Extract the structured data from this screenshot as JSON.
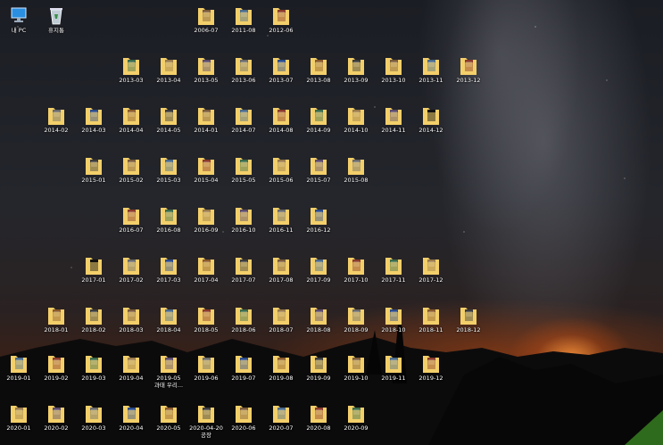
{
  "desktop": {
    "system_icons": [
      {
        "label": "내 PC",
        "icon": "this-pc-icon"
      },
      {
        "label": "휴지통",
        "icon": "recycle-bin-icon"
      }
    ],
    "folder_rows": [
      [
        "2006-07",
        "2011-08",
        "2012-06"
      ],
      [
        "2013-03",
        "2013-04",
        "2013-05",
        "2013-06",
        "2013-07",
        "2013-08",
        "2013-09",
        "2013-10",
        "2013-11",
        "2013-12"
      ],
      [
        "2014-02",
        "2014-03",
        "2014-04",
        "2014-05",
        "2014-01",
        "2014-07",
        "2014-08",
        "2014-09",
        "2014-10",
        "2014-11",
        "2014-12"
      ],
      [
        "2015-01",
        "2015-02",
        "2015-03",
        "2015-04",
        "2015-05",
        "2015-06",
        "2015-07",
        "2015-08"
      ],
      [
        "2016-07",
        "2016-08",
        "2016-09",
        "2016-10",
        "2016-11",
        "2016-12"
      ],
      [
        "2017-01",
        "2017-02",
        "2017-03",
        "2017-04",
        "2017-07",
        "2017-08",
        "2017-09",
        "2017-10",
        "2017-11",
        "2017-12"
      ],
      [
        "2018-01",
        "2018-02",
        "2018-03",
        "2018-04",
        "2018-05",
        "2018-06",
        "2018-07",
        "2018-08",
        "2018-09",
        "2018-10",
        "2018-11",
        "2018-12"
      ],
      [
        "2019-01",
        "2019-02",
        "2019-03",
        "2019-04",
        "2019-05",
        "2019-06",
        "2019-07",
        "2019-08",
        "2019-09",
        "2019-10",
        "2019-11",
        "2019-12"
      ],
      [
        "2020-01",
        "2020-02",
        "2020-03",
        "2020-04",
        "2020-05",
        "2020-04-20",
        "2020-06",
        "2020-07",
        "2020-08",
        "2020-09"
      ]
    ],
    "second_lines": {
      "2019-05": "과태 우리...",
      "2020-04-20": "공장"
    },
    "folder_icon": "folder-icon",
    "colors": {
      "folder_yellow": "#f3cf6a",
      "label_text": "#ffffff"
    }
  }
}
